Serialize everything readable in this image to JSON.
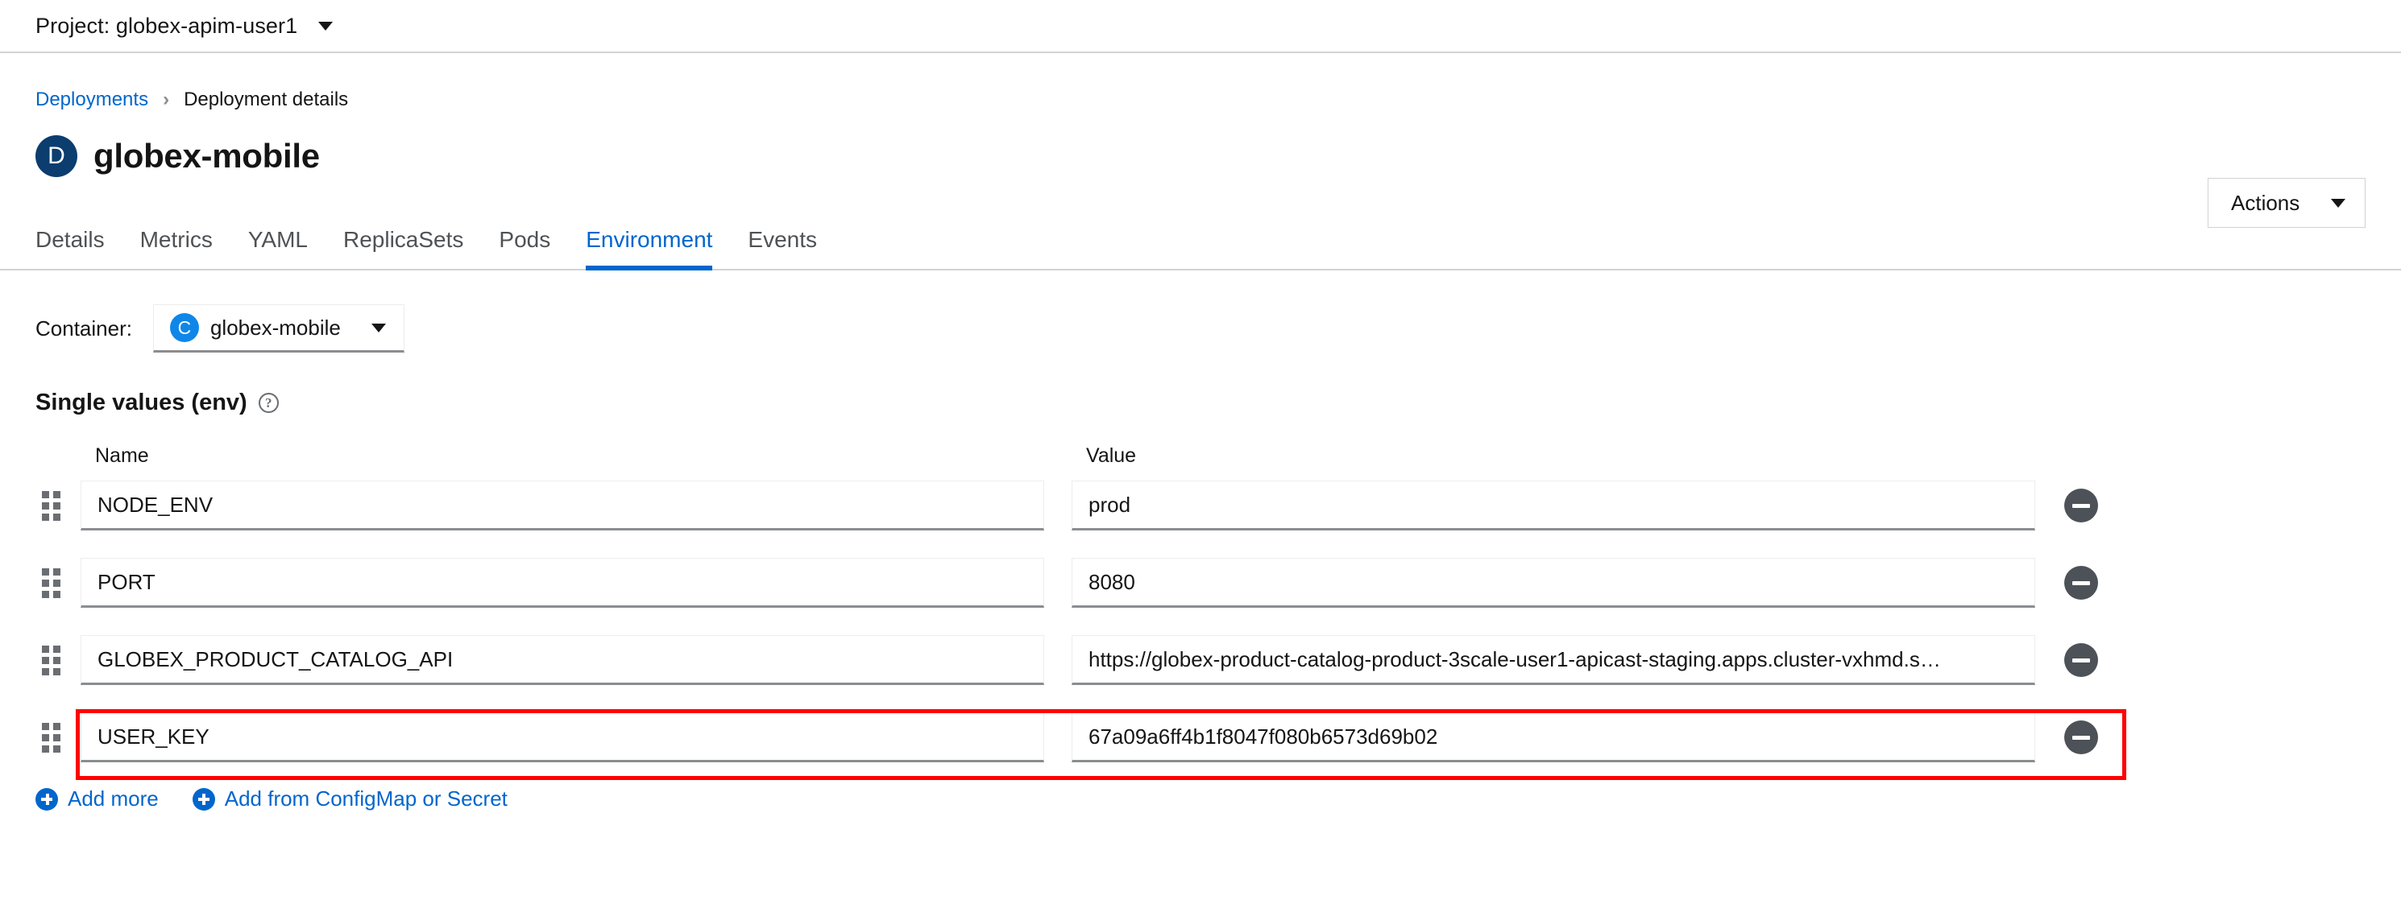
{
  "project_bar": {
    "label": "Project: globex-apim-user1",
    "caret_icon": "chevron-down-icon"
  },
  "breadcrumb": {
    "parent": "Deployments",
    "separator": "›",
    "current": "Deployment details"
  },
  "header": {
    "badge_letter": "D",
    "badge_color": "#0b3d6e",
    "title": "globex-mobile",
    "actions_label": "Actions"
  },
  "tabs": [
    {
      "label": "Details",
      "active": false
    },
    {
      "label": "Metrics",
      "active": false
    },
    {
      "label": "YAML",
      "active": false
    },
    {
      "label": "ReplicaSets",
      "active": false
    },
    {
      "label": "Pods",
      "active": false
    },
    {
      "label": "Environment",
      "active": true
    },
    {
      "label": "Events",
      "active": false
    }
  ],
  "container_selector": {
    "label": "Container:",
    "badge_letter": "C",
    "badge_color": "#0f87e8",
    "selected": "globex-mobile",
    "caret_icon": "chevron-down-icon"
  },
  "section": {
    "title": "Single values (env)",
    "help_icon": "help-circle-icon",
    "help_glyph": "?"
  },
  "env_table": {
    "columns": {
      "name": "Name",
      "value": "Value"
    },
    "rows": [
      {
        "name": "NODE_ENV",
        "value": "prod",
        "highlighted": false
      },
      {
        "name": "PORT",
        "value": "8080",
        "highlighted": false
      },
      {
        "name": "GLOBEX_PRODUCT_CATALOG_API",
        "value": "https://globex-product-catalog-product-3scale-user1-apicast-staging.apps.cluster-vxhmd.s…",
        "highlighted": false
      },
      {
        "name": "USER_KEY",
        "value": "67a09a6ff4b1f8047f080b6573d69b02",
        "highlighted": true
      }
    ],
    "remove_icon": "minus-circle-icon",
    "drag_icon": "drag-grip-icon",
    "highlight_color": "#ff0000"
  },
  "footer_links": [
    {
      "label": "Add more",
      "icon": "plus-circle-icon"
    },
    {
      "label": "Add from ConfigMap or Secret",
      "icon": "plus-circle-icon"
    }
  ],
  "accent_color": "#0066cc"
}
